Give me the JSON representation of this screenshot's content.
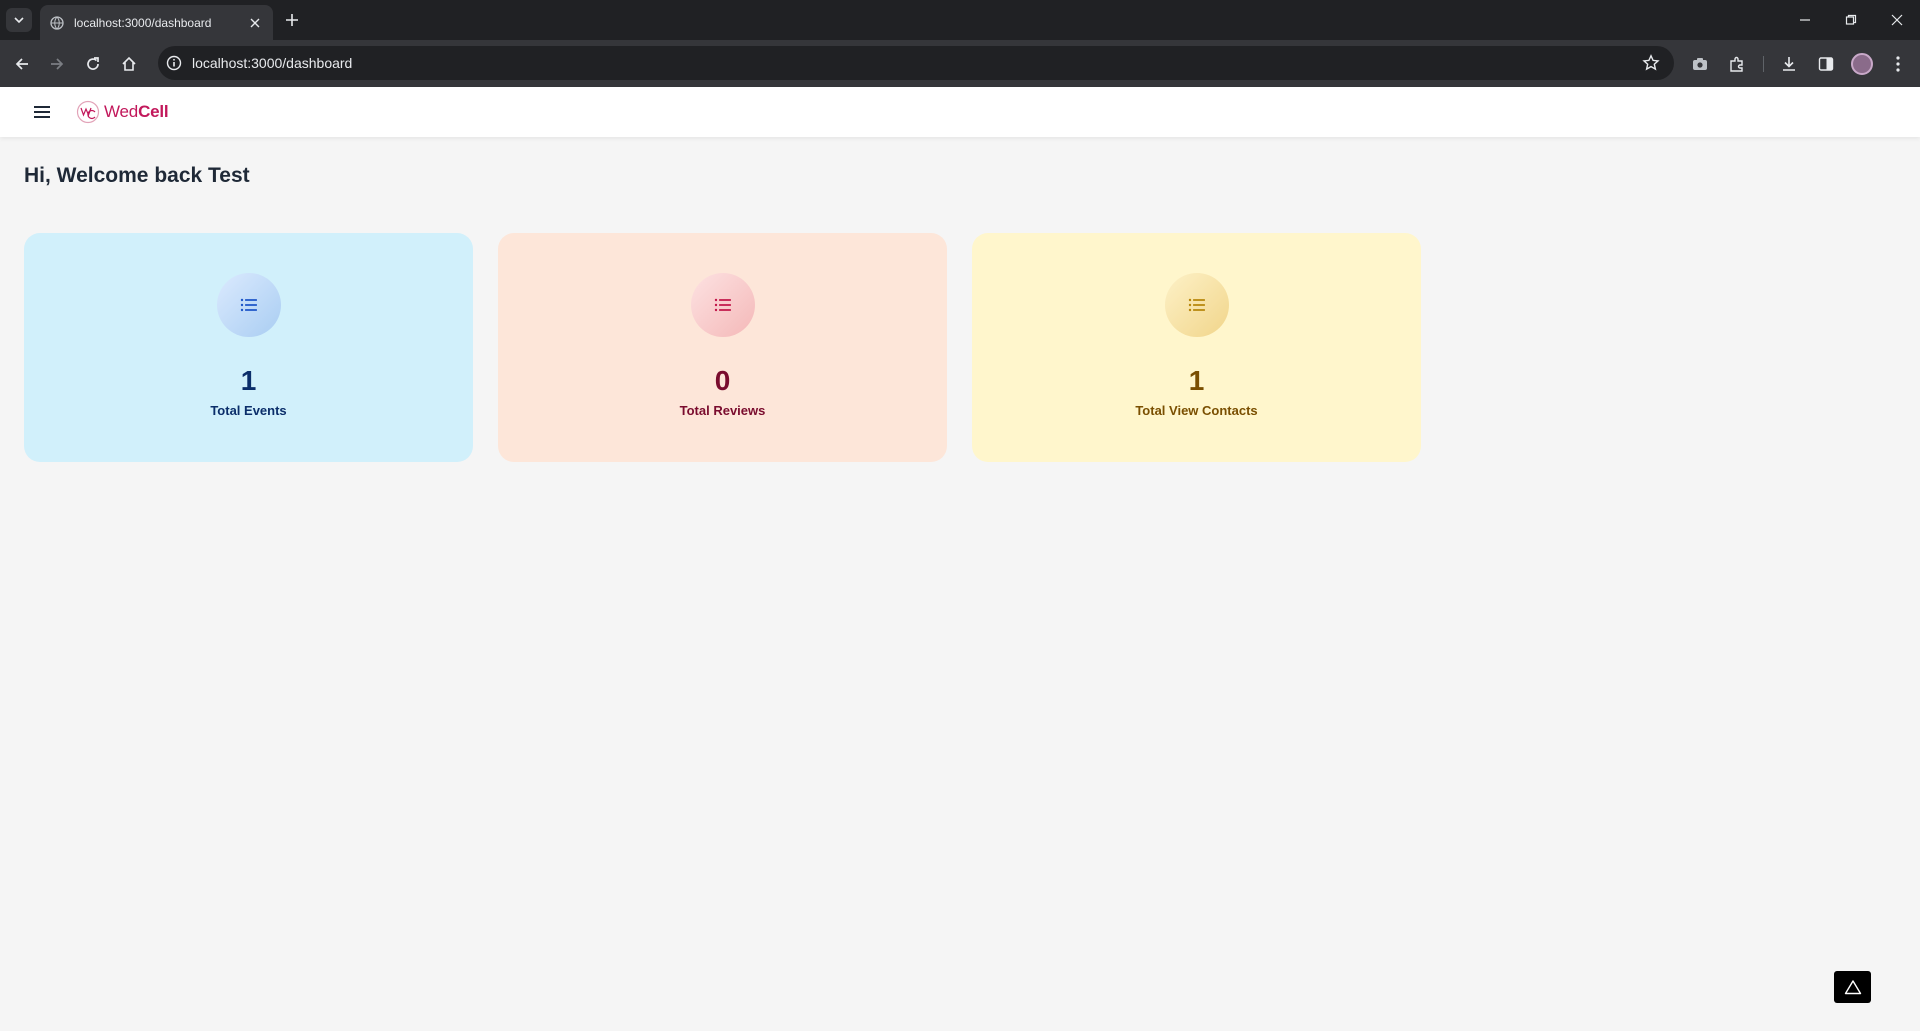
{
  "browser": {
    "tab_title": "localhost:3000/dashboard",
    "url": "localhost:3000/dashboard"
  },
  "app": {
    "brand_prefix": "Wed",
    "brand_suffix": "Cell",
    "brand_color": "#c2185b"
  },
  "page": {
    "greeting": "Hi, Welcome back Test"
  },
  "stats": [
    {
      "value": "1",
      "label": "Total Events",
      "icon": "list-icon",
      "color": "#0b2e6a",
      "background": "#d1f0fb"
    },
    {
      "value": "0",
      "label": "Total Reviews",
      "icon": "list-icon",
      "color": "#7a0c2e",
      "background": "#fde6d9"
    },
    {
      "value": "1",
      "label": "Total View Contacts",
      "icon": "list-icon",
      "color": "#7a4f01",
      "background": "#fff6cc"
    }
  ],
  "icons": {
    "tab_favicon": "globe-icon",
    "tab_close": "close-icon",
    "new_tab": "plus-icon",
    "back": "arrow-left-icon",
    "forward": "arrow-right-icon",
    "reload": "reload-icon",
    "home": "home-icon",
    "site_info": "info-icon",
    "bookmark": "star-icon",
    "menu": "hamburger-icon",
    "floating": "triangle-icon"
  }
}
